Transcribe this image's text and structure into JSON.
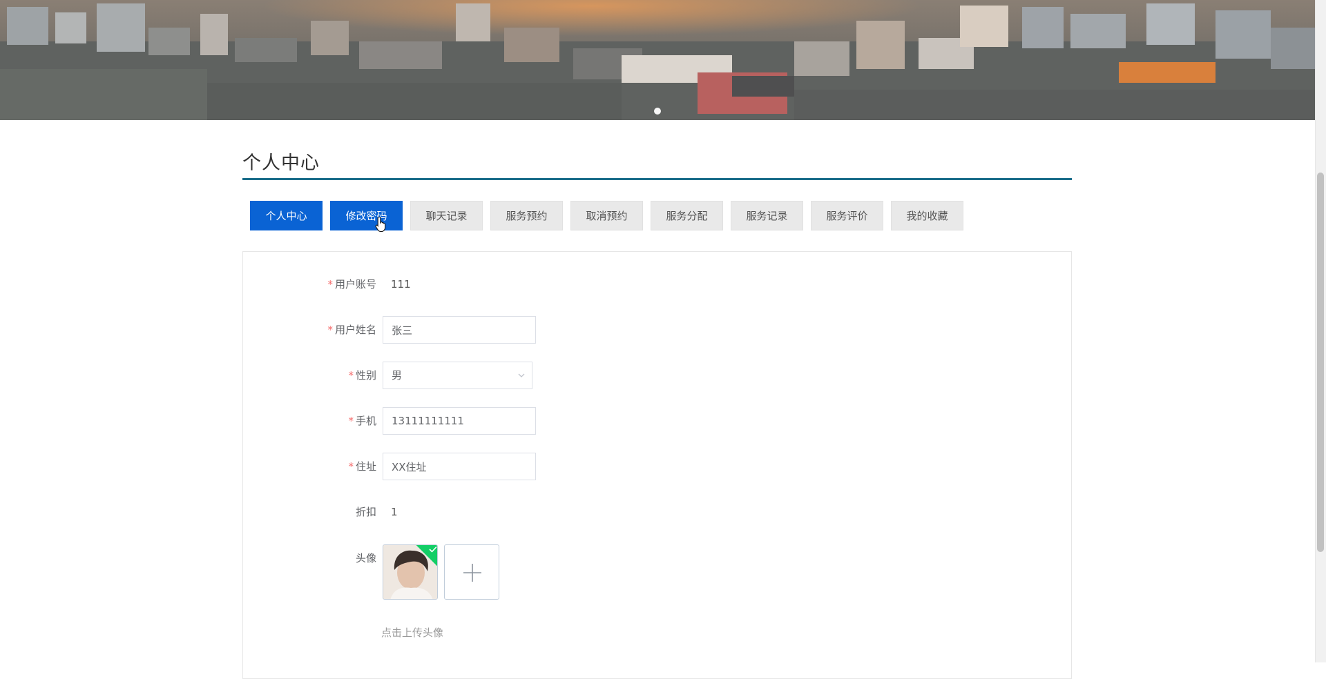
{
  "page": {
    "title": "个人中心"
  },
  "tabs": [
    {
      "label": "个人中心",
      "active": true
    },
    {
      "label": "修改密码",
      "active": true
    },
    {
      "label": "聊天记录",
      "active": false
    },
    {
      "label": "服务预约",
      "active": false
    },
    {
      "label": "取消预约",
      "active": false
    },
    {
      "label": "服务分配",
      "active": false
    },
    {
      "label": "服务记录",
      "active": false
    },
    {
      "label": "服务评价",
      "active": false
    },
    {
      "label": "我的收藏",
      "active": false
    }
  ],
  "form": {
    "account": {
      "label": "用户账号",
      "required_mark": "*",
      "value": "111"
    },
    "name": {
      "label": "用户姓名",
      "required_mark": "*",
      "value": "张三"
    },
    "gender": {
      "label": "性别",
      "required_mark": "*",
      "value": "男"
    },
    "phone": {
      "label": "手机",
      "required_mark": "*",
      "value": "13111111111"
    },
    "address": {
      "label": "住址",
      "required_mark": "*",
      "value": "XX住址"
    },
    "discount": {
      "label": "折扣",
      "value": "1"
    },
    "avatar": {
      "label": "头像",
      "upload_hint": "点击上传头像"
    }
  },
  "colors": {
    "primary": "#0a63d4",
    "title_rule": "#1a6d8a",
    "required": "#f56c6c",
    "success": "#13ce66"
  }
}
